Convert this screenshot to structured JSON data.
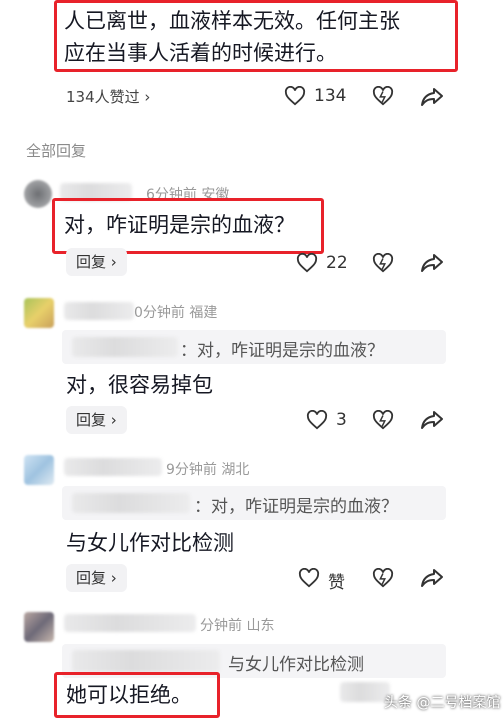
{
  "top_comment": {
    "line1": "人已离世，血液样本无效。任何主张",
    "line2": "应在当事人活着的时候进行。",
    "likes_summary": "134人赞过 ›",
    "like_count": "134"
  },
  "section_title": "全部回复",
  "replies": [
    {
      "meta": "6分钟前  安徽",
      "text": "对，咋证明是宗的血液？",
      "reply_label": "回复 ›",
      "like_count": "22"
    },
    {
      "meta": "0分钟前  福建",
      "quote": "：对，咋证明是宗的血液？",
      "text": "对，很容易掉包",
      "reply_label": "回复 ›",
      "like_count": "3"
    },
    {
      "meta": "9分钟前  湖北",
      "quote": "：对，咋证明是宗的血液？",
      "text": "与女儿作对比检测",
      "reply_label": "回复 ›",
      "like_count": "赞"
    },
    {
      "meta": "分钟前  山东",
      "quote": "与女儿作对比检测",
      "text": "她可以拒绝。"
    }
  ],
  "watermark": "头条 @二号档案馆",
  "colors": {
    "highlight": "#e8222a",
    "meta_text": "#9a9a9a"
  }
}
